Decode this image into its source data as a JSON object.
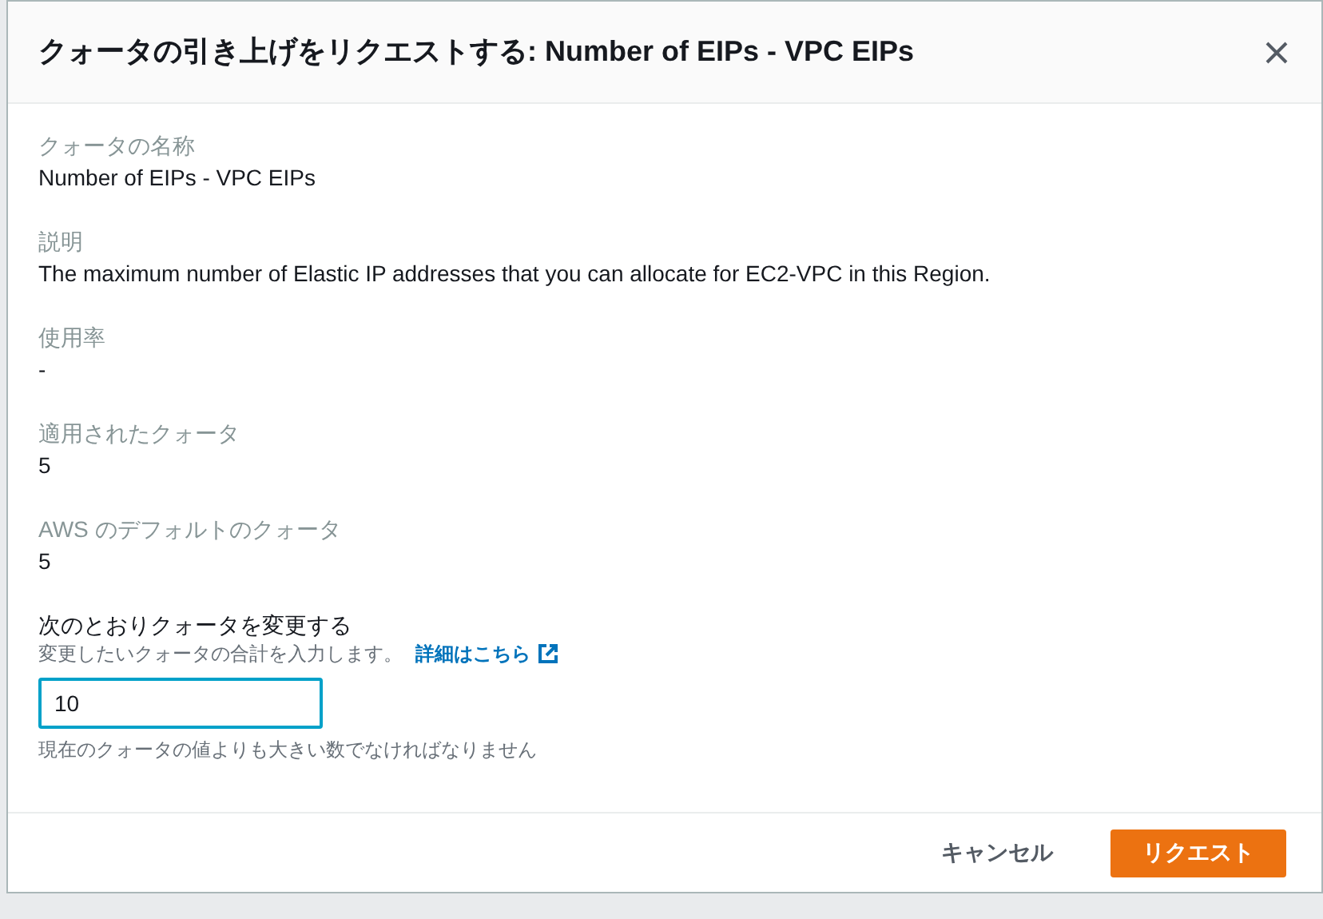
{
  "dialog": {
    "title": "クォータの引き上げをリクエストする: Number of EIPs - VPC EIPs"
  },
  "fields": [
    {
      "label": "クォータの名称",
      "value": "Number of EIPs - VPC EIPs"
    },
    {
      "label": "説明",
      "value": "The maximum number of Elastic IP addresses that you can allocate for EC2-VPC in this Region."
    },
    {
      "label": "使用率",
      "value": "-"
    },
    {
      "label": "適用されたクォータ",
      "value": "5"
    },
    {
      "label": "AWS のデフォルトのクォータ",
      "value": "5"
    }
  ],
  "change": {
    "label": "次のとおりクォータを変更する",
    "hint": "変更したいクォータの合計を入力します。",
    "link": "詳細はこちら",
    "value": "10",
    "constraint": "現在のクォータの値よりも大きい数でなければなりません"
  },
  "buttons": [
    {
      "label": "キャンセル",
      "kind": "link"
    },
    {
      "label": "リクエスト",
      "kind": "primary"
    }
  ]
}
